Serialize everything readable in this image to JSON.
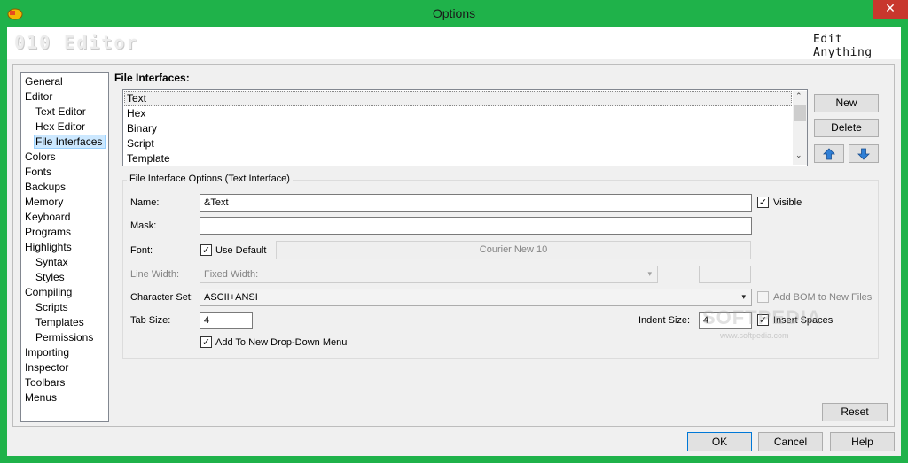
{
  "window": {
    "title": "Options",
    "close_glyph": "✕"
  },
  "banner": {
    "logo": "010 Editor",
    "tagline": "Edit Anything"
  },
  "tree": {
    "items": [
      {
        "label": "General",
        "level": 0
      },
      {
        "label": "Editor",
        "level": 0
      },
      {
        "label": "Text Editor",
        "level": 1
      },
      {
        "label": "Hex Editor",
        "level": 1
      },
      {
        "label": "File Interfaces",
        "level": 1,
        "selected": true
      },
      {
        "label": "Colors",
        "level": 0
      },
      {
        "label": "Fonts",
        "level": 0
      },
      {
        "label": "Backups",
        "level": 0
      },
      {
        "label": "Memory",
        "level": 0
      },
      {
        "label": "Keyboard",
        "level": 0
      },
      {
        "label": "Programs",
        "level": 0
      },
      {
        "label": "Highlights",
        "level": 0
      },
      {
        "label": "Syntax",
        "level": 1
      },
      {
        "label": "Styles",
        "level": 1
      },
      {
        "label": "Compiling",
        "level": 0
      },
      {
        "label": "Scripts",
        "level": 1
      },
      {
        "label": "Templates",
        "level": 1
      },
      {
        "label": "Permissions",
        "level": 1
      },
      {
        "label": "Importing",
        "level": 0
      },
      {
        "label": "Inspector",
        "level": 0
      },
      {
        "label": "Toolbars",
        "level": 0
      },
      {
        "label": "Menus",
        "level": 0
      }
    ]
  },
  "file_interfaces": {
    "label": "File Interfaces:",
    "items": [
      "Text",
      "Hex",
      "Binary",
      "Script",
      "Template"
    ],
    "selected": "Text",
    "new_label": "New",
    "delete_label": "Delete"
  },
  "options": {
    "group_title": "File Interface Options (Text Interface)",
    "name_label": "Name:",
    "name_value": "&Text",
    "visible_label": "Visible",
    "visible_checked": true,
    "mask_label": "Mask:",
    "mask_value": "",
    "font_label": "Font:",
    "use_default_label": "Use Default",
    "use_default_checked": true,
    "font_button": "Courier New 10",
    "line_width_label": "Line Width:",
    "line_width_value": "Fixed Width:",
    "line_width_number": "",
    "charset_label": "Character Set:",
    "charset_value": "ASCII+ANSI",
    "add_bom_label": "Add BOM to New Files",
    "add_bom_checked": false,
    "tab_size_label": "Tab Size:",
    "tab_size_value": "4",
    "indent_size_label": "Indent Size:",
    "indent_size_value": "4",
    "insert_spaces_label": "Insert Spaces",
    "insert_spaces_checked": true,
    "add_dropdown_label": "Add To New Drop-Down Menu",
    "add_dropdown_checked": true
  },
  "buttons": {
    "reset": "Reset",
    "ok": "OK",
    "cancel": "Cancel",
    "help": "Help"
  },
  "watermark": {
    "main": "SOFTPEDIA",
    "sub": "www.softpedia.com"
  },
  "colors": {
    "window_frame": "#1fb24a",
    "close_button": "#c8372d",
    "arrow_blue": "#2f7fd6",
    "selection": "#cce8ff"
  }
}
